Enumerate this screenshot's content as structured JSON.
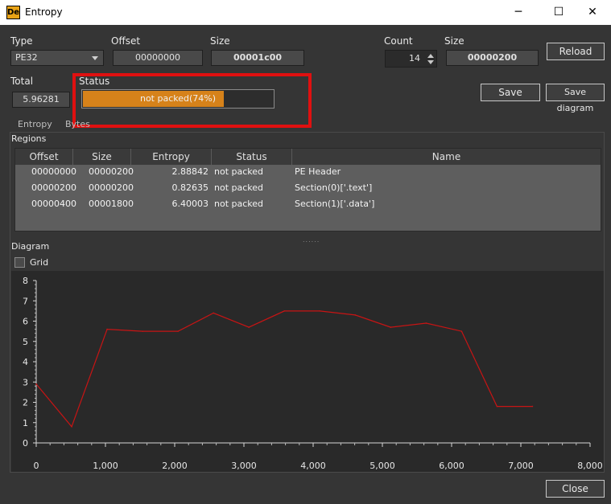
{
  "window": {
    "title": "Entropy",
    "icon_text": "De",
    "controls": {
      "minimize": "─",
      "maximize": "☐",
      "close": "✕"
    }
  },
  "top": {
    "type_label": "Type",
    "type_value": "PE32",
    "offset_label": "Offset",
    "offset_value": "00000000",
    "size_label": "Size",
    "size_value": "00001c00",
    "count_label": "Count",
    "count_value": "14",
    "size2_label": "Size",
    "size2_value": "00000200",
    "reload_label": "Reload",
    "total_label": "Total",
    "total_value": "5.96281",
    "status_label": "Status",
    "status_text": "not packed(74%)",
    "status_percent": 74,
    "save_label": "Save",
    "save_diagram_label": "Save diagram"
  },
  "tabs": [
    "Entropy",
    "Bytes"
  ],
  "regions": {
    "title": "Regions",
    "columns": [
      "Offset",
      "Size",
      "Entropy",
      "Status",
      "Name"
    ],
    "rows": [
      [
        "00000000",
        "00000200",
        "2.88842",
        "not packed",
        "PE Header"
      ],
      [
        "00000200",
        "00000200",
        "0.82635",
        "not packed",
        "Section(0)['.text']"
      ],
      [
        "00000400",
        "00001800",
        "6.40003",
        "not packed",
        "Section(1)['.data']"
      ]
    ]
  },
  "splitter_grip": "......",
  "diagram": {
    "title": "Diagram",
    "grid_label": "Grid",
    "grid_checked": false
  },
  "chart_data": {
    "type": "line",
    "x": [
      0,
      512,
      1024,
      1536,
      2048,
      2560,
      3072,
      3584,
      4096,
      4608,
      5120,
      5632,
      6144,
      6656,
      7168
    ],
    "y": [
      2.9,
      0.8,
      5.6,
      5.5,
      5.5,
      6.4,
      5.7,
      6.5,
      6.5,
      6.3,
      5.7,
      5.9,
      5.5,
      1.8,
      1.8
    ],
    "xlim": [
      0,
      8000
    ],
    "ylim": [
      0,
      8
    ],
    "xticks": [
      "0",
      "1,000",
      "2,000",
      "3,000",
      "4,000",
      "5,000",
      "6,000",
      "7,000",
      "8,000"
    ],
    "yticks": [
      "0",
      "1",
      "2",
      "3",
      "4",
      "5",
      "6",
      "7",
      "8"
    ],
    "line_color": "#c81414",
    "grid": false
  },
  "footer": {
    "close_label": "Close"
  },
  "colors": {
    "accent": "#d6821a",
    "highlight": "#e01010",
    "background": "#353535"
  }
}
